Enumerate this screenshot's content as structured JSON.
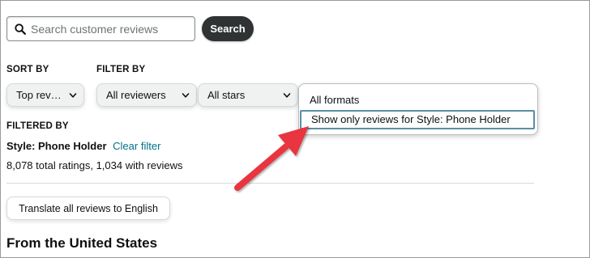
{
  "search": {
    "placeholder": "Search customer reviews",
    "value": "",
    "button_label": "Search",
    "icon": "search-icon"
  },
  "sort": {
    "label": "SORT BY",
    "selected": "Top rev…"
  },
  "filter": {
    "label": "FILTER BY",
    "reviewers": "All reviewers",
    "stars": "All stars",
    "format_menu": {
      "items": [
        "All formats",
        "Show only reviews for Style: Phone Holder"
      ],
      "highlighted_index": 1
    }
  },
  "filtered_by": {
    "label": "FILTERED BY",
    "style_value": "Style: Phone Holder",
    "clear_label": "Clear filter",
    "ratings_summary": "8,078 total ratings, 1,034 with reviews"
  },
  "translate_button": "Translate all reviews to English",
  "region_heading": "From the United States",
  "colors": {
    "link": "#007185",
    "search_button": "#303333",
    "annotation_arrow": "#e8353f",
    "focus_outline": "#5a8fa6"
  }
}
